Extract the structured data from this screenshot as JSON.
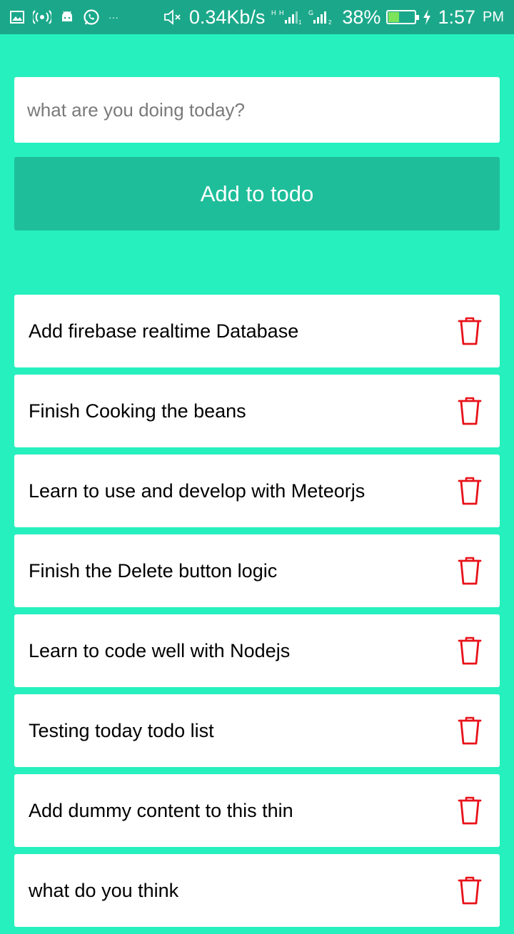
{
  "status_bar": {
    "network_speed": "0.34Kb/s",
    "battery_percent": "38%",
    "battery_level": 0.38,
    "time": "1:57",
    "ampm": "PM",
    "overflow": "···"
  },
  "input": {
    "placeholder": "what are you doing today?",
    "value": ""
  },
  "add_button": {
    "label": "Add to todo"
  },
  "todos": [
    {
      "text": "Add firebase realtime Database"
    },
    {
      "text": "Finish Cooking the beans"
    },
    {
      "text": "Learn to use and develop with Meteorjs"
    },
    {
      "text": "Finish the Delete button logic"
    },
    {
      "text": "Learn to code well with Nodejs"
    },
    {
      "text": "Testing today todo list"
    },
    {
      "text": "Add dummy content to this thin"
    },
    {
      "text": "what do you think"
    }
  ],
  "colors": {
    "background": "#26F0BE",
    "status_bar": "#1BA88A",
    "button": "#1EBE9A",
    "delete_icon": "#E8121A"
  }
}
